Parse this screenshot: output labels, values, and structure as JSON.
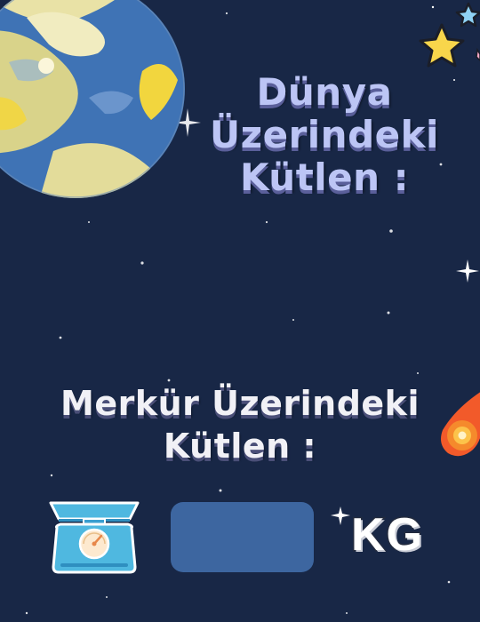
{
  "earth": {
    "heading_lines": [
      "Dünya",
      "Üzerindeki",
      "Kütlen :"
    ]
  },
  "mercury": {
    "heading_lines": [
      "Merkür Üzerindeki",
      "Kütlen :"
    ]
  },
  "weight_input": {
    "value": ""
  },
  "unit_label": "KG",
  "icons": [
    "earth-planet-icon",
    "star-icon",
    "meteor-icon",
    "scale-icon",
    "sparkle-icon"
  ],
  "colors": {
    "background": "#182746",
    "earth_heading": "#bcc5f5",
    "mercury_heading": "#f1f1f6",
    "input_box": "#3d66a0",
    "scale_teal": "#4fb8e0",
    "star_yellow": "#f8d64b",
    "meteor_orange": "#f25a2a"
  }
}
